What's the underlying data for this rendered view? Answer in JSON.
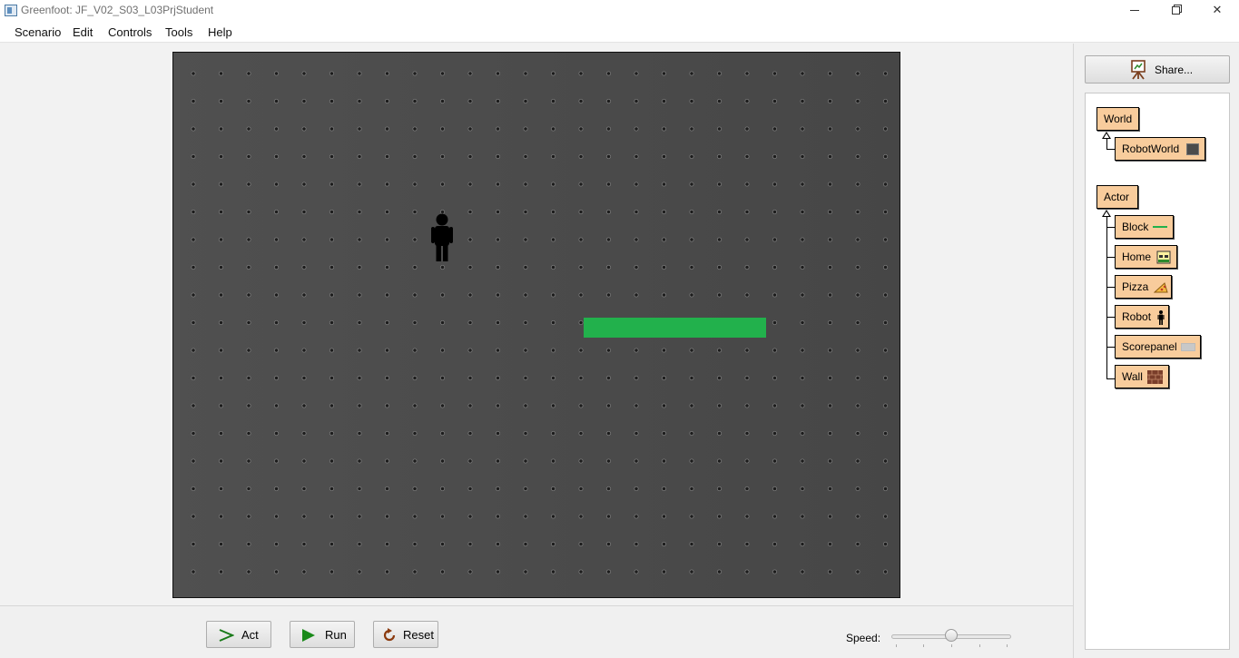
{
  "window": {
    "title": "Greenfoot: JF_V02_S03_L03PrjStudent",
    "minimize_glyph": "—",
    "restore_glyph": "❐",
    "close_glyph": "✕"
  },
  "menu": {
    "items": [
      {
        "label": "Scenario"
      },
      {
        "label": "Edit"
      },
      {
        "label": "Controls"
      },
      {
        "label": "Tools"
      },
      {
        "label": "Help"
      }
    ]
  },
  "controls": {
    "act_label": "Act",
    "run_label": "Run",
    "reset_label": "Reset",
    "speed_label": "Speed:",
    "speed_value": 0.5,
    "act_icon": "act-arrow-icon",
    "run_icon": "run-triangle-icon",
    "reset_icon": "reset-circular-arrow-icon"
  },
  "share": {
    "label": "Share...",
    "icon": "easel-icon"
  },
  "class_tree": {
    "world_root": {
      "label": "World"
    },
    "world_subclasses": [
      {
        "label": "RobotWorld",
        "icon": "metal-texture-thumbnail"
      }
    ],
    "actor_root": {
      "label": "Actor"
    },
    "actor_subclasses": [
      {
        "label": "Block",
        "icon": "green-bar-thumbnail"
      },
      {
        "label": "Home",
        "icon": "home-thumbnail"
      },
      {
        "label": "Pizza",
        "icon": "pizza-slice-thumbnail"
      },
      {
        "label": "Robot",
        "icon": "robot-figure-thumbnail"
      },
      {
        "label": "Scorepanel",
        "icon": "grey-panel-thumbnail"
      },
      {
        "label": "Wall",
        "icon": "brick-wall-thumbnail"
      }
    ]
  },
  "world": {
    "background": "riveted-metal-plate",
    "actors": [
      {
        "class": "Robot"
      },
      {
        "class": "Block"
      }
    ]
  },
  "colors": {
    "class_box": "#f8cc9c",
    "block_green": "#22b14c",
    "world_bg": "#4a4a4a"
  }
}
